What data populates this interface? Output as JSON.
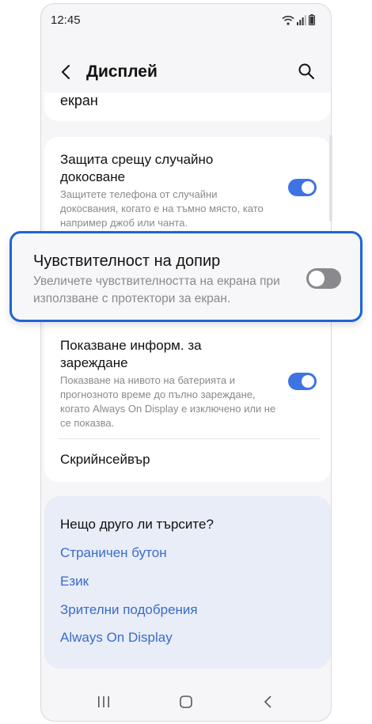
{
  "status_bar": {
    "time": "12:45"
  },
  "header": {
    "title": "Дисплей"
  },
  "top_item": {
    "label": "екран"
  },
  "settings": {
    "accidental_touch": {
      "title": "Защита срещу случайно докосване",
      "description": "Защитете телефона от случайни докосвания, когато е на тъмно място, като например джоб или чанта.",
      "enabled": true
    },
    "touch_sensitivity": {
      "title": "Чувствителност на допир",
      "description": "Увеличете чувствителността на екрана при използване с протектори за екран.",
      "enabled": false
    },
    "charging_info": {
      "title": "Показване информ. за зареждане",
      "description": "Показване на нивото на батерията и прогнозното време до пълно зареждане, когато Always On Display е изключено или не се показва.",
      "enabled": true
    },
    "screensaver": {
      "title": "Скрийнсейвър"
    }
  },
  "suggestions": {
    "title": "Нещо друго ли търсите?",
    "links": [
      "Страничен бутон",
      "Език",
      "Зрителни подобрения",
      "Always On Display"
    ]
  },
  "colors": {
    "accent": "#3e73e4",
    "highlight_border": "#1f64d6",
    "link": "#3a6cc8"
  }
}
